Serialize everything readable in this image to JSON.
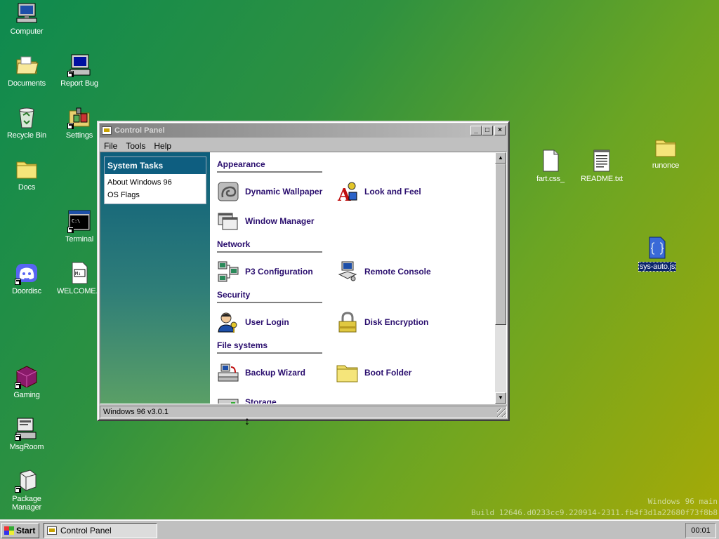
{
  "desktop": {
    "icons": [
      {
        "label": "Computer"
      },
      {
        "label": "Documents"
      },
      {
        "label": "Report Bug"
      },
      {
        "label": "Recycle Bin"
      },
      {
        "label": "Settings"
      },
      {
        "label": "Docs"
      },
      {
        "label": "Terminal"
      },
      {
        "label": "Doordisc"
      },
      {
        "label": "WELCOME..."
      },
      {
        "label": "Gaming"
      },
      {
        "label": "MsgRoom"
      },
      {
        "label": "Package Manager"
      },
      {
        "label": "fart.css_"
      },
      {
        "label": "README.txt"
      },
      {
        "label": "runonce"
      },
      {
        "label": "sys-auto.js"
      }
    ],
    "watermark": {
      "line1": "Windows 96 main",
      "line2": "Build 12646.d0233cc9.220914-2311.fb4f3d1a22680f73f8b8"
    }
  },
  "window": {
    "title": "Control Panel",
    "buttons": {
      "minimize": "_",
      "maximize": "□",
      "close": "×"
    },
    "menu": [
      "File",
      "Tools",
      "Help"
    ],
    "sidebar": {
      "heading": "System Tasks",
      "items": [
        "About Windows 96",
        "OS Flags"
      ]
    },
    "sections": [
      {
        "title": "Appearance",
        "items": [
          "Dynamic Wallpaper",
          "Look and Feel",
          "Window Manager"
        ]
      },
      {
        "title": "Network",
        "items": [
          "P3 Configuration",
          "Remote Console"
        ]
      },
      {
        "title": "Security",
        "items": [
          "User Login",
          "Disk Encryption"
        ]
      },
      {
        "title": "File systems",
        "items": [
          "Backup Wizard",
          "Boot Folder",
          "Storage"
        ]
      }
    ],
    "status": "Windows 96 v3.0.1"
  },
  "taskbar": {
    "start_label": "Start",
    "tasks": [
      "Control Panel"
    ],
    "clock": "00:01"
  },
  "colors": {
    "sidebar_top": "#0d5e7c",
    "section_text": "#2a0e6e",
    "desktop_green": "#0e8a4f",
    "desktop_yellow": "#a7aa06"
  }
}
